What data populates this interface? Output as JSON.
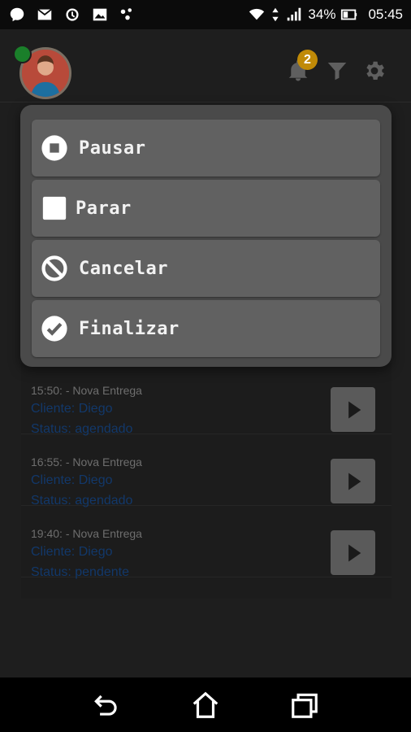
{
  "status_bar": {
    "battery_percent": "34%",
    "time": "05:45",
    "left_icons": [
      "messenger-icon",
      "gmail-icon",
      "sync-icon",
      "image-icon",
      "dots-icon"
    ],
    "right_icons": [
      "wifi-icon",
      "data-arrows-icon",
      "signal-icon",
      "battery-icon"
    ]
  },
  "header": {
    "notification_count": "2",
    "online_color": "#1a7f2a",
    "badge_color": "#c08a07"
  },
  "menu": {
    "items": [
      {
        "label": "Pausar",
        "icon": "pause-circle-icon"
      },
      {
        "label": "Parar",
        "icon": "stop-square-icon"
      },
      {
        "label": "Cancelar",
        "icon": "cancel-circle-icon"
      },
      {
        "label": "Finalizar",
        "icon": "check-circle-icon"
      }
    ]
  },
  "deliveries": [
    {
      "time": "15:50: - Nova Entrega",
      "client": "Cliente: Diego",
      "status": "Status: agendado"
    },
    {
      "time": "16:55: - Nova Entrega",
      "client": "Cliente: Diego",
      "status": "Status: agendado"
    },
    {
      "time": "19:40: - Nova Entrega",
      "client": "Cliente: Diego",
      "status": "Status: pendente"
    }
  ],
  "nav": {
    "buttons": [
      "back-icon",
      "home-icon",
      "recent-apps-icon"
    ]
  }
}
